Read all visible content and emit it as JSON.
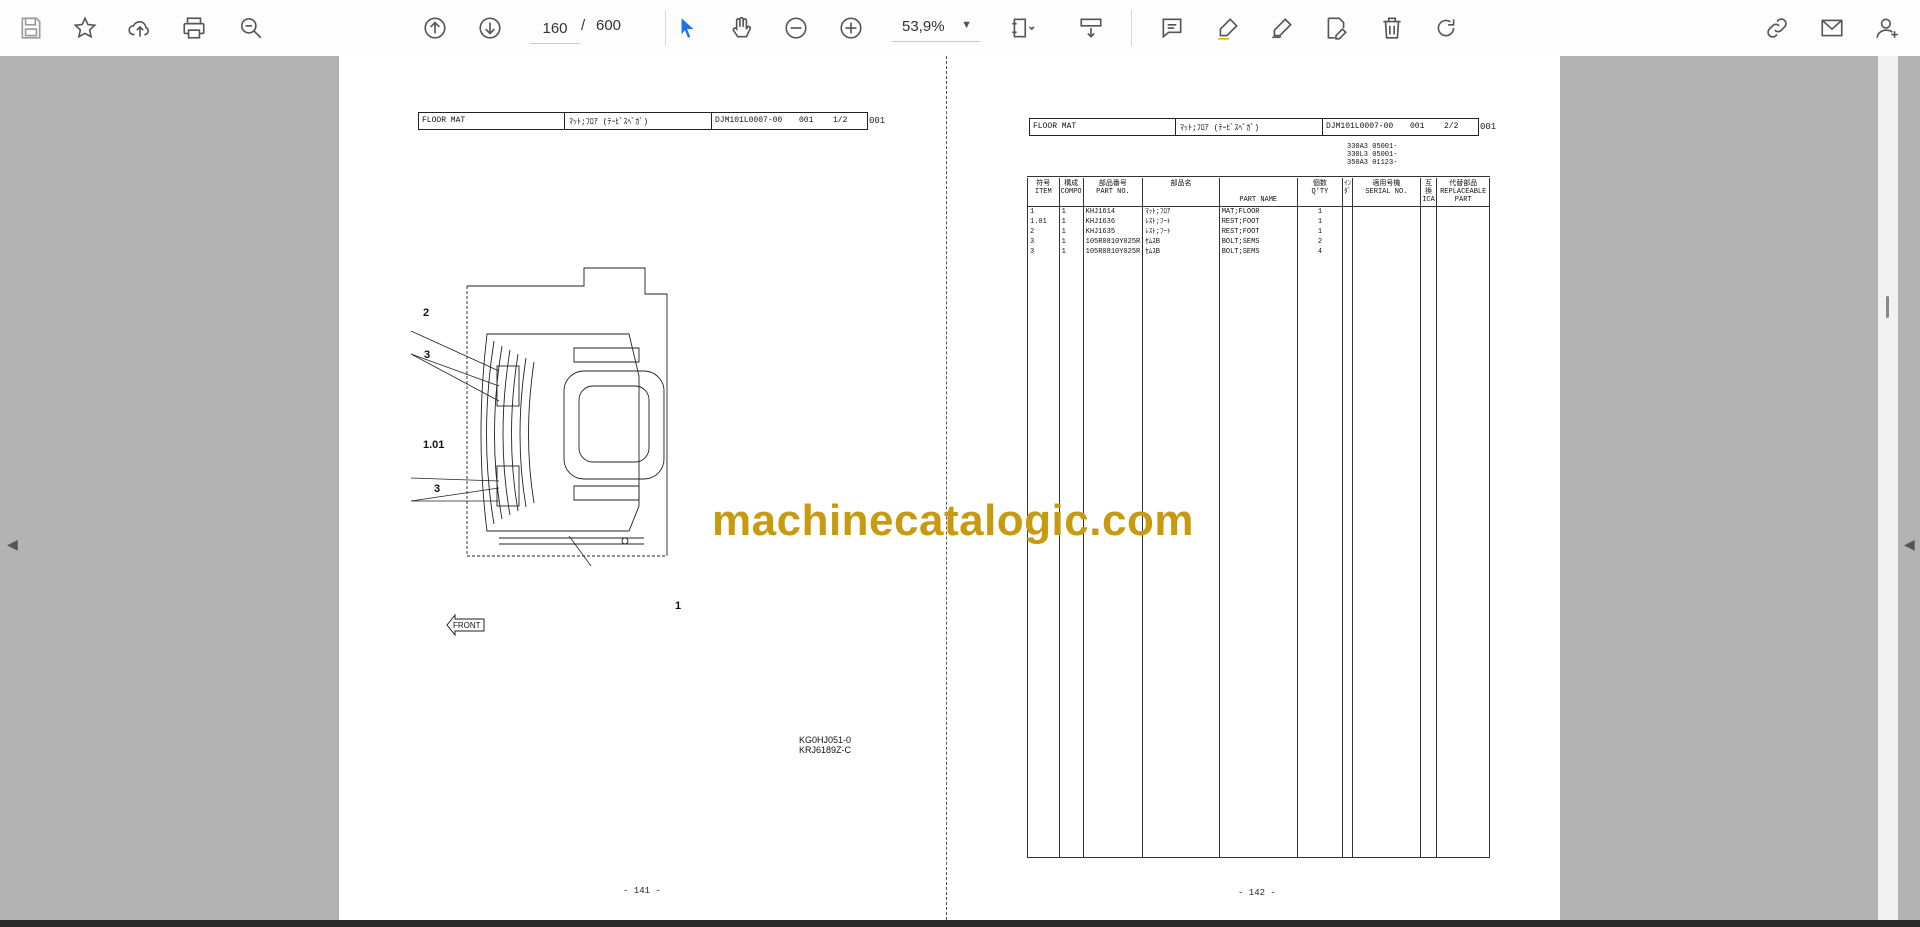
{
  "toolbar": {
    "current_page": "160",
    "page_separator": "/",
    "total_pages": "600",
    "zoom": "53,9%"
  },
  "left_page": {
    "header": {
      "name_en": "FLOOR MAT",
      "name_jp": "ﾏｯﾄ;ﾌﾛｱ (ﾃｰﾋﾞｽﾍﾞｶﾞ)",
      "drawing_no": "DJM101L0007-00",
      "rev": "001",
      "sheet": "1/2",
      "extra": "001"
    },
    "callouts": [
      "2",
      "3",
      "1.01",
      "3",
      "1"
    ],
    "front_label": "FRONT",
    "drawing_codes": [
      "KG0HJ051-0",
      "KRJ6189Z-C"
    ],
    "page_number": "- 141 -"
  },
  "right_page": {
    "header": {
      "name_en": "FLOOR MAT",
      "name_jp": "ﾏｯﾄ;ﾌﾛｱ (ﾃｰﾋﾞｽﾍﾞｶﾞ)",
      "drawing_no": "DJM101L0007-00",
      "rev": "001",
      "sheet": "2/2",
      "extra": "001"
    },
    "serials": [
      "330A3 05001-",
      "330L3 05001-",
      "350A3 01123-"
    ],
    "columns": {
      "item": "符号\nITEM",
      "compo": "構成\nCOMPO",
      "part_no": "部品番号\nPART NO.",
      "name_jp": "部品名",
      "part_name": "PART NAME",
      "qty": "個数\nQ'TY",
      "ind": "ｲﾝﾀﾞ",
      "serial": "適用号機\nSERIAL NO.",
      "ica": "互換\nICA",
      "replace": "代替部品\nREPLACEABLE\nPART"
    },
    "rows": [
      {
        "item": "1",
        "compo": "1",
        "part_no": "KHJ1614",
        "name_jp": "ﾏｯﾄ;ﾌﾛｱ",
        "part_name": "MAT;FLOOR",
        "qty": "1"
      },
      {
        "item": "1.01",
        "compo": "1",
        "part_no": "KHJ1636",
        "name_jp": "ﾚｽﾄ;ﾌｰﾄ",
        "part_name": "REST;FOOT",
        "qty": "1"
      },
      {
        "item": "2",
        "compo": "1",
        "part_no": "KHJ1635",
        "name_jp": "ﾚｽﾄ;ﾌｰﾄ",
        "part_name": "REST;FOOT",
        "qty": "1"
      },
      {
        "item": "3",
        "compo": "1",
        "part_no": "105R0810Y025R",
        "name_jp": "ｾﾑｽB",
        "part_name": "BOLT;SEMS",
        "qty": "2"
      },
      {
        "item": "3",
        "compo": "1",
        "part_no": "105R0810Y025R",
        "name_jp": "ｾﾑｽB",
        "part_name": "BOLT;SEMS",
        "qty": "4"
      }
    ],
    "page_number": "- 142 -"
  },
  "watermark": "machinecatalogic.com",
  "colors": {
    "accent": "#1a73e8",
    "watermark": "#c79a10",
    "toolbar_bg": "#fdfdfd",
    "viewport_bg": "#b3b3b3"
  }
}
